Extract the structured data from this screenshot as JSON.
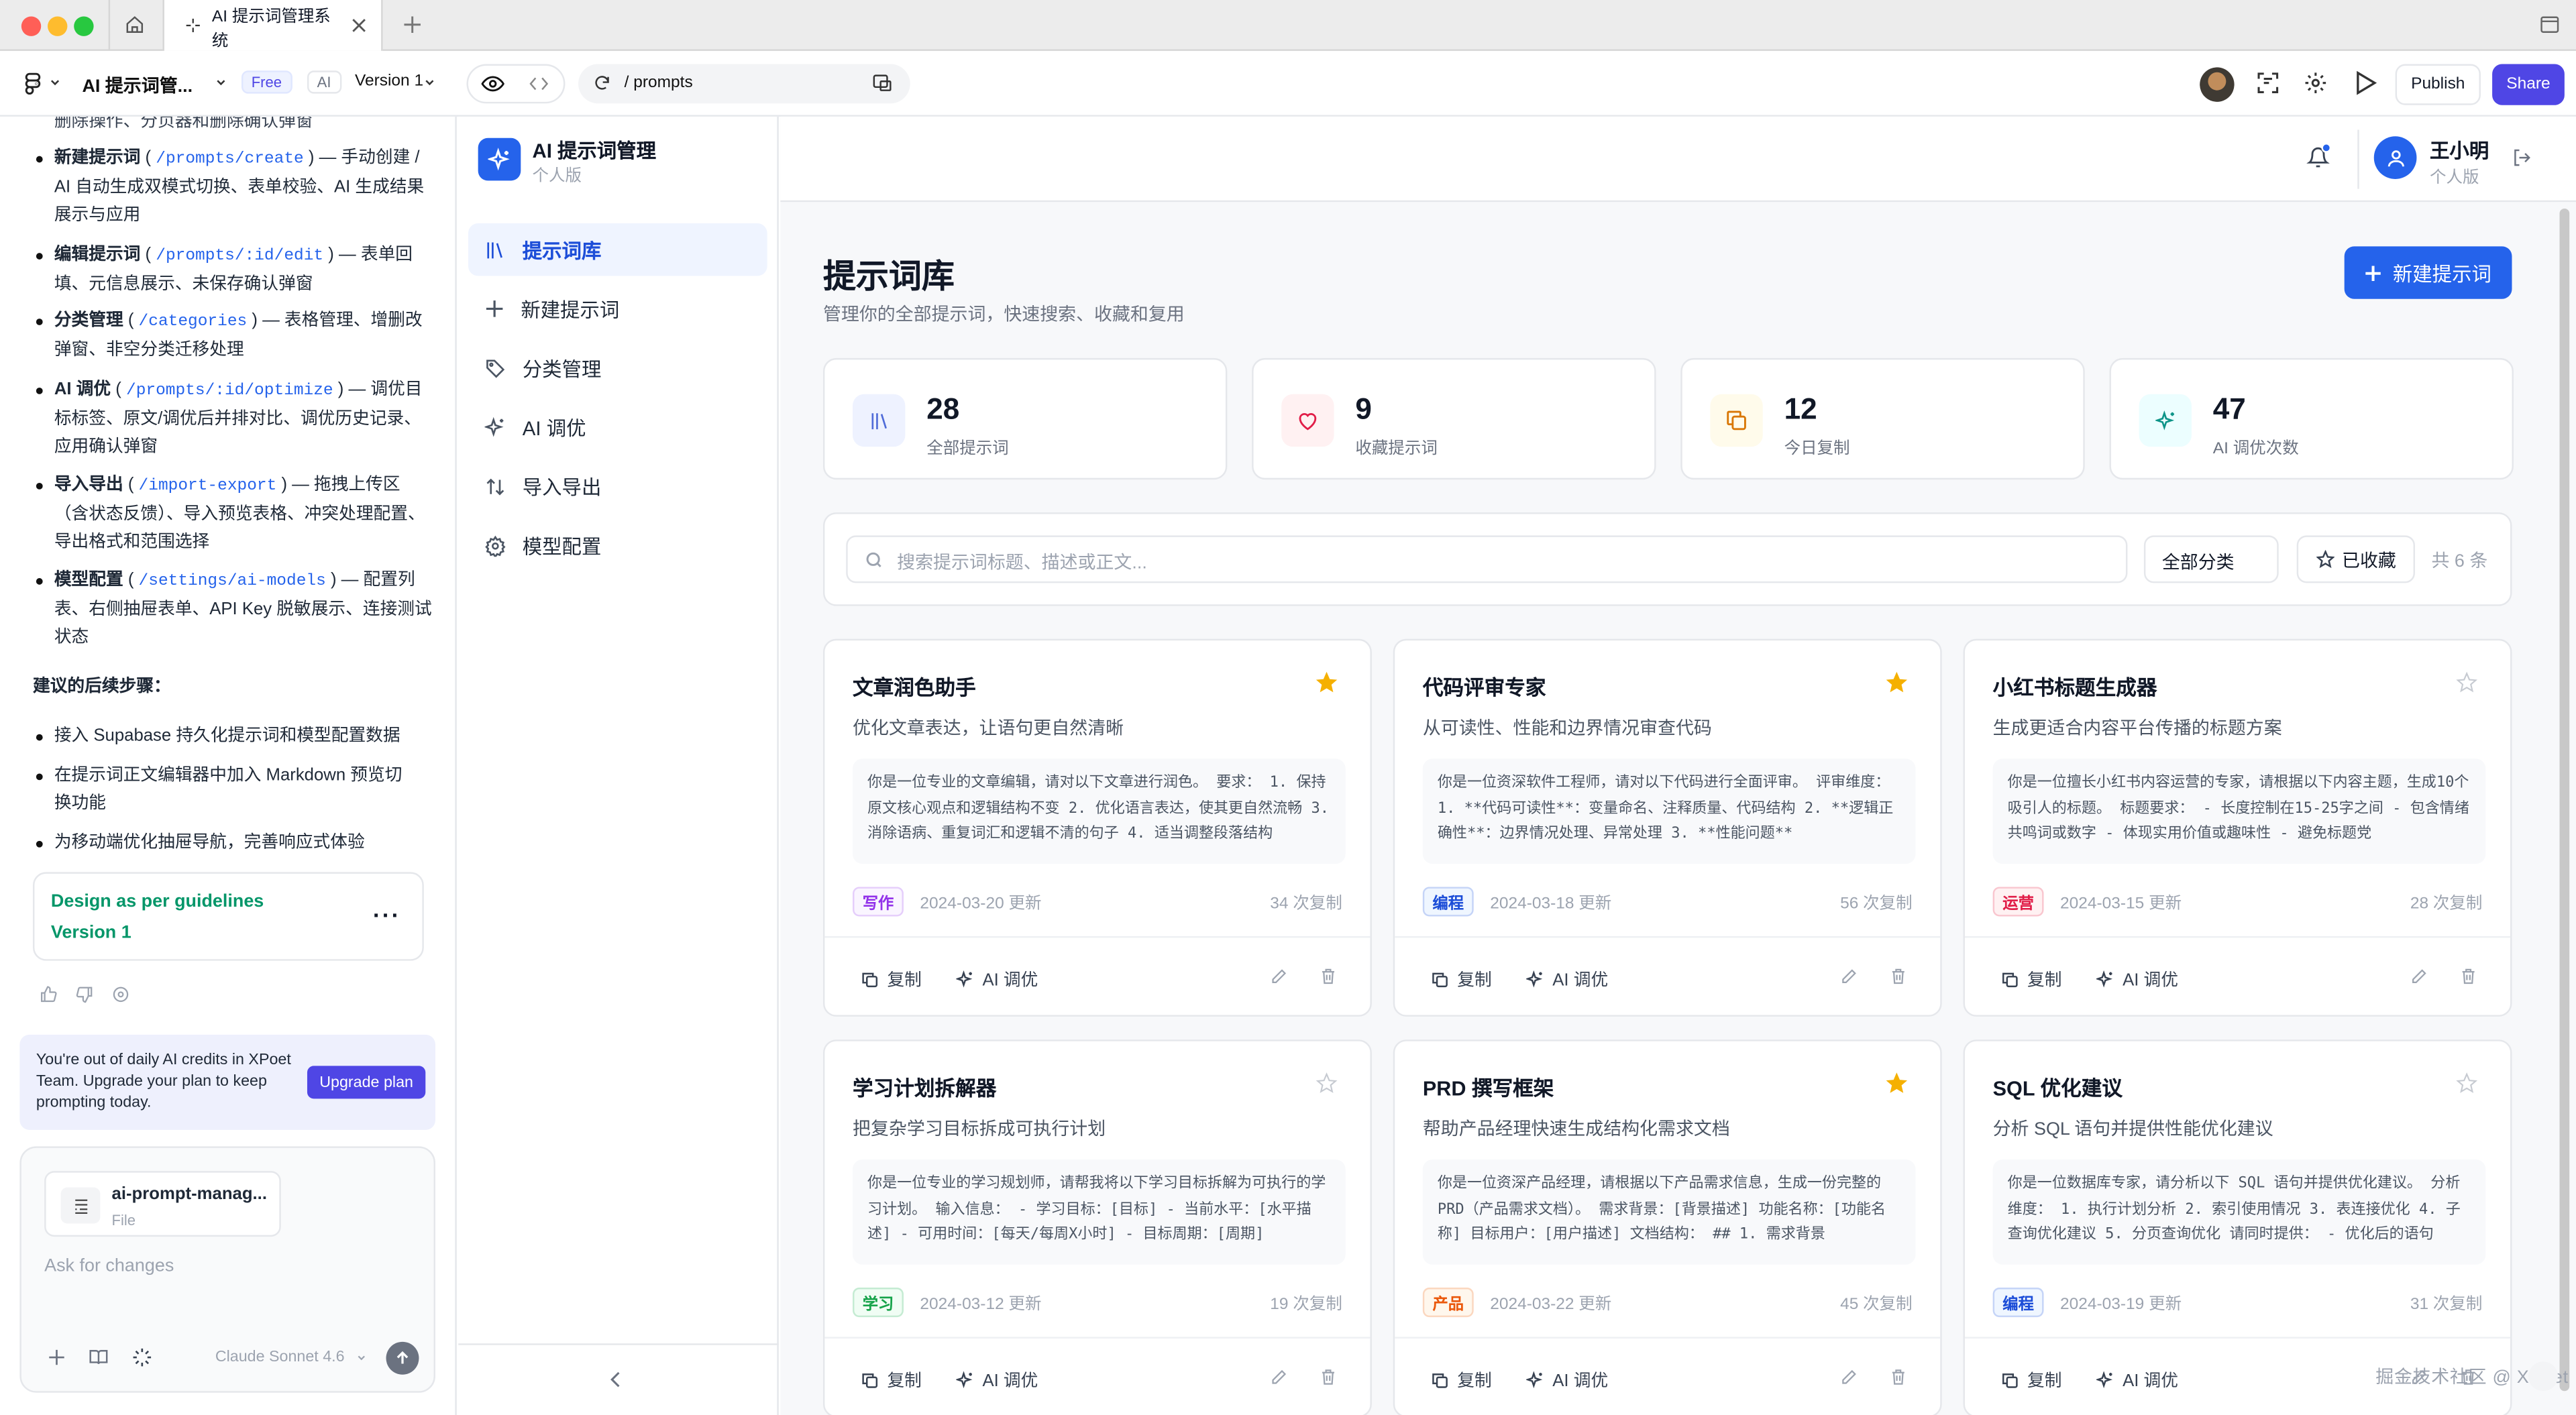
{
  "browser": {
    "tab_title": "AI 提示词管理系统"
  },
  "toolbar": {
    "project_name": "AI 提示词管...",
    "plan_badge": "Free",
    "ai_badge": "AI",
    "version": "Version 1",
    "url": "/ prompts",
    "publish": "Publish",
    "share": "Share"
  },
  "chat": {
    "top_cut": "删除操作、分页器和删除确认弹窗",
    "items": [
      {
        "a": "新建提示词 ( ",
        "code": "/prompts/create",
        "b": " ) — 手动创建 / AI 自动生成双模式切换、表单校验、AI 生成结果展示与应用"
      },
      {
        "a": "编辑提示词 ( ",
        "code": "/prompts/:id/edit",
        "b": " ) — 表单回填、元信息展示、未保存确认弹窗"
      },
      {
        "a": "分类管理 ( ",
        "code": "/categories",
        "b": " ) — 表格管理、增删改弹窗、非空分类迁移处理"
      },
      {
        "a": "AI 调优 ( ",
        "code": "/prompts/:id/optimize",
        "b": " ) — 调优目标标签、原文/调优后并排对比、调优历史记录、应用确认弹窗"
      },
      {
        "a": "导入导出 ( ",
        "code": "/import-export",
        "b": " ) — 拖拽上传区（含状态反馈）、导入预览表格、冲突处理配置、导出格式和范围选择"
      },
      {
        "a": "模型配置 ( ",
        "code": "/settings/ai-models",
        "b": " ) — 配置列表、右侧抽屉表单、API Key 脱敏展示、连接测试状态"
      }
    ],
    "next_title": "建议的后续步骤：",
    "next_items": [
      "接入 Supabase 持久化提示词和模型配置数据",
      "在提示词正文编辑器中加入 Markdown 预览切换功能",
      "为移动端优化抽屉导航，完善响应式体验"
    ],
    "design_title": "Design as per guidelines",
    "design_version": "Version 1",
    "upgrade_text": "You're out of daily AI credits in XPoet Team. Upgrade your plan to keep prompting today.",
    "upgrade_btn": "Upgrade plan",
    "file_name": "ai-prompt-manag...",
    "file_type": "File",
    "input_placeholder": "Ask for changes",
    "model": "Claude Sonnet 4.6"
  },
  "sidebar": {
    "app_name": "AI 提示词管理",
    "edition": "个人版",
    "items": [
      {
        "label": "提示词库",
        "icon": "library-icon"
      },
      {
        "label": "新建提示词",
        "icon": "plus-icon"
      },
      {
        "label": "分类管理",
        "icon": "tag-icon"
      },
      {
        "label": "AI 调优",
        "icon": "sparkles-icon"
      },
      {
        "label": "导入导出",
        "icon": "arrows-icon"
      },
      {
        "label": "模型配置",
        "icon": "gear-icon"
      }
    ]
  },
  "user": {
    "name": "王小明",
    "edition": "个人版"
  },
  "page": {
    "title": "提示词库",
    "subtitle": "管理你的全部提示词，快速搜索、收藏和复用",
    "new_btn": "新建提示词"
  },
  "stats": [
    {
      "value": "28",
      "label": "全部提示词",
      "color": "#4f6bd8",
      "bg": "#eef2ff",
      "icon": "library-icon"
    },
    {
      "value": "9",
      "label": "收藏提示词",
      "color": "#e11d48",
      "bg": "#fff1f2",
      "icon": "heart-icon"
    },
    {
      "value": "12",
      "label": "今日复制",
      "color": "#d97706",
      "bg": "#fffbeb",
      "icon": "copy-icon"
    },
    {
      "value": "47",
      "label": "AI 调优次数",
      "color": "#0d9488",
      "bg": "#ecfeff",
      "icon": "sparkles-icon"
    }
  ],
  "search": {
    "placeholder": "搜索提示词标题、描述或正文...",
    "category": "全部分类",
    "fav": "已收藏",
    "count": "共 6 条"
  },
  "cards": [
    {
      "title": "文章润色助手",
      "desc": "优化文章表达，让语句更自然清晰",
      "body": "你是一位专业的文章编辑，请对以下文章进行润色。 要求： 1. 保持原文核心观点和逻辑结构不变 2. 优化语言表达，使其更自然流畅 3. 消除语病、重复词汇和逻辑不清的句子 4. 适当调整段落结构",
      "tag": "写作",
      "tag_color": "#9333ea",
      "tag_bg": "#faf5ff",
      "updated": "2024-03-20 更新",
      "copies": "34 次复制",
      "starred": true,
      "copy": "复制",
      "ai": "AI 调优"
    },
    {
      "title": "代码评审专家",
      "desc": "从可读性、性能和边界情况审查代码",
      "body": "你是一位资深软件工程师，请对以下代码进行全面评审。 评审维度： 1. **代码可读性**：变量命名、注释质量、代码结构 2. **逻辑正确性**：边界情况处理、异常处理 3. **性能问题**",
      "tag": "编程",
      "tag_color": "#1d4ed8",
      "tag_bg": "#eff6ff",
      "updated": "2024-03-18 更新",
      "copies": "56 次复制",
      "starred": true,
      "copy": "复制",
      "ai": "AI 调优"
    },
    {
      "title": "小红书标题生成器",
      "desc": "生成更适合内容平台传播的标题方案",
      "body": "你是一位擅长小红书内容运营的专家，请根据以下内容主题，生成10个吸引人的标题。 标题要求： - 长度控制在15-25字之间 - 包含情绪共鸣词或数字 - 体现实用价值或趣味性 - 避免标题党",
      "tag": "运营",
      "tag_color": "#e11d48",
      "tag_bg": "#fff1f2",
      "updated": "2024-03-15 更新",
      "copies": "28 次复制",
      "starred": false,
      "copy": "复制",
      "ai": "AI 调优"
    },
    {
      "title": "学习计划拆解器",
      "desc": "把复杂学习目标拆成可执行计划",
      "body": "你是一位专业的学习规划师，请帮我将以下学习目标拆解为可执行的学习计划。 输入信息： - 学习目标：[目标] - 当前水平：[水平描述] - 可用时间：[每天/每周X小时] - 目标周期：[周期]",
      "tag": "学习",
      "tag_color": "#16a34a",
      "tag_bg": "#f0fdf4",
      "updated": "2024-03-12 更新",
      "copies": "19 次复制",
      "starred": false,
      "copy": "复制",
      "ai": "AI 调优"
    },
    {
      "title": "PRD 撰写框架",
      "desc": "帮助产品经理快速生成结构化需求文档",
      "body": "你是一位资深产品经理，请根据以下产品需求信息，生成一份完整的 PRD（产品需求文档）。 需求背景：[背景描述] 功能名称：[功能名称] 目标用户：[用户描述] 文档结构： ## 1. 需求背景",
      "tag": "产品",
      "tag_color": "#ea580c",
      "tag_bg": "#fff7ed",
      "updated": "2024-03-22 更新",
      "copies": "45 次复制",
      "starred": true,
      "copy": "复制",
      "ai": "AI 调优"
    },
    {
      "title": "SQL 优化建议",
      "desc": "分析 SQL 语句并提供性能优化建议",
      "body": "你是一位数据库专家，请分析以下 SQL 语句并提供优化建议。 分析维度： 1. 执行计划分析 2. 索引使用情况 3. 表连接优化 4. 子查询优化建议 5. 分页查询优化 请同时提供： - 优化后的语句",
      "tag": "编程",
      "tag_color": "#1d4ed8",
      "tag_bg": "#eff6ff",
      "updated": "2024-03-19 更新",
      "copies": "31 次复制",
      "starred": false,
      "copy": "复制",
      "ai": "AI 调优"
    }
  ],
  "watermark": "掘金技术社区 @ XPoet"
}
